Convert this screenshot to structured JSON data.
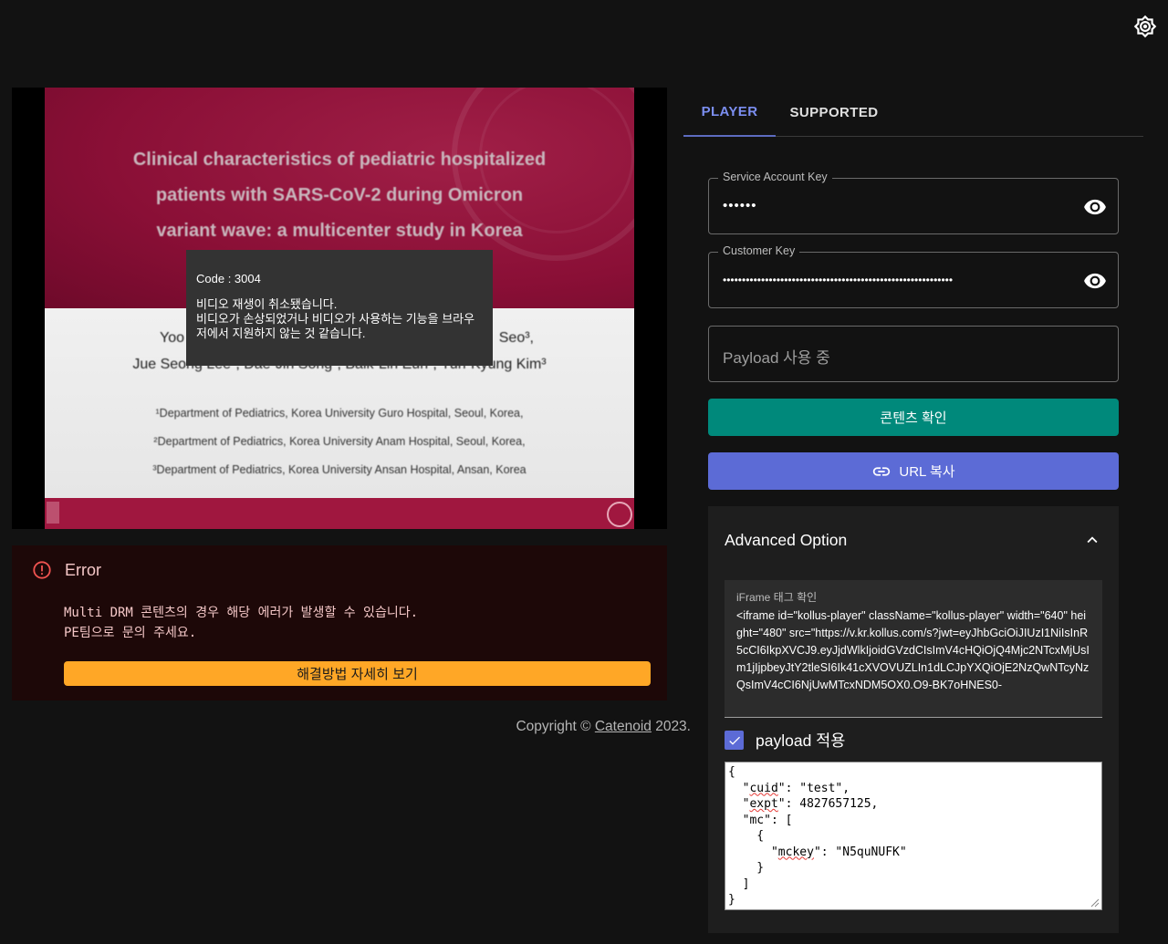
{
  "header": {
    "theme_icon": "brightness-icon"
  },
  "video": {
    "slide": {
      "title_lines": [
        "Clinical characteristics of pediatric hospitalized",
        "patients with SARS-CoV-2 during Omicron",
        "variant wave: a multicenter study in Korea"
      ],
      "authors_line1_left": "Yoo",
      "authors_line1_right": "Seo³,",
      "authors_line2": "Jue Seong Lee¹, Dae-Jin Song¹, Baik-Lin Eun¹, Yun-Kyung Kim³",
      "affiliations": [
        "¹Department of Pediatrics, Korea University Guro Hospital, Seoul, Korea,",
        "²Department of Pediatrics, Korea University Anam Hospital, Seoul, Korea,",
        "³Department of Pediatrics, Korea University Ansan Hospital, Ansan, Korea"
      ]
    },
    "overlay": {
      "code": "Code : 3004",
      "line1": "비디오 재생이 취소됐습니다.",
      "line2": "비디오가 손상되었거나 비디오가 사용하는 기능을 브라우저에서 지원하지 않는 것 같습니다."
    }
  },
  "error": {
    "title": "Error",
    "message": "Multi DRM 콘텐츠의 경우 해당 에러가 발생할 수 있습니다.\nPE팀으로 문의 주세요.",
    "button": "해결방법 자세히 보기",
    "color": "#f4c7c7"
  },
  "footer": {
    "prefix": "Copyright © ",
    "link": "Catenoid",
    "suffix": " 2023."
  },
  "tabs": [
    {
      "label": "PLAYER",
      "active": true
    },
    {
      "label": "SUPPORTED",
      "active": false
    }
  ],
  "form": {
    "service_key": {
      "label": "Service Account Key",
      "value": "••••••"
    },
    "customer_key": {
      "label": "Customer Key",
      "value": "••••••••••••••••••••••••••••••••••••••••••••••••••••••••••••"
    },
    "payload_placeholder": "Payload 사용 중",
    "check_button": "콘텐츠 확인",
    "copy_button": "URL 복사"
  },
  "advanced": {
    "title": "Advanced Option",
    "iframe_label": "iFrame 태그 확인",
    "iframe_code": "<iframe id=\"kollus-player\" className=\"kollus-player\" width=\"640\" height=\"480\" src=\"https://v.kr.kollus.com/s?jwt=eyJhbGciOiJIUzI1NiIsInR5cCI6IkpXVCJ9.eyJjdWlkIjoidGVzdCIsImV4cHQiOjQ4Mjc2NTcxMjUsIm1jIjpbeyJtY2tleSI6Ik41cXVOVUZLIn1dLCJpYXQiOjE2NzQwNTcyNzQsImV4cCI6NjUwMTcxNDM5OX0.O9-BK7oHNES0-",
    "payload_checkbox": "payload 적용",
    "payload_lines": [
      "{",
      "  \"cuid\": \"test\",",
      "  \"expt\": 4827657125,",
      "  \"mc\": [",
      "    {",
      "      \"mckey\": \"N5quNUFK\"",
      "    }",
      "  ]",
      "}"
    ]
  },
  "colors": {
    "accent": "#5c6bd6",
    "teal": "#00897b",
    "warning": "#ffa726",
    "tab_active": "#7b8ef0"
  }
}
